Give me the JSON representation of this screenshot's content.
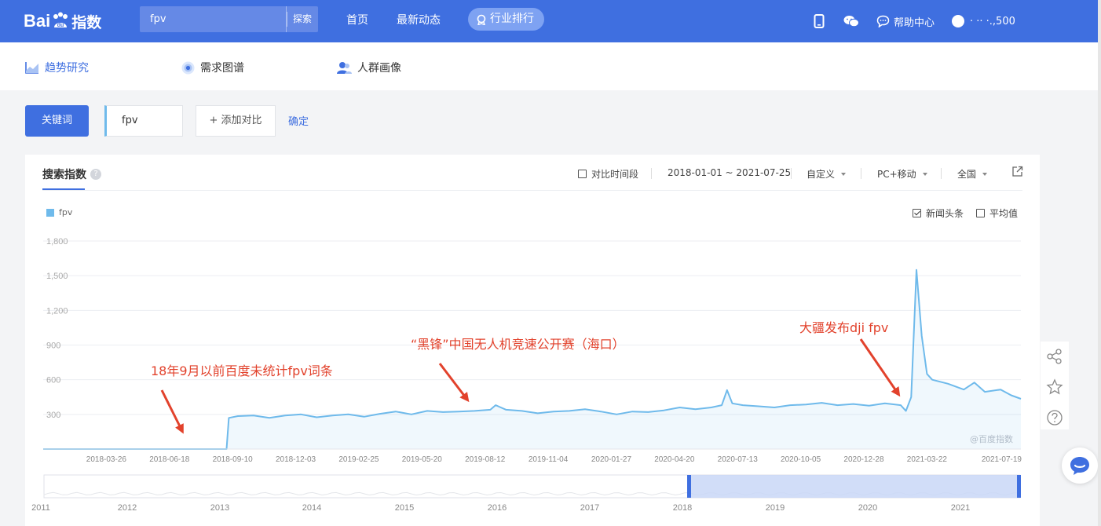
{
  "header": {
    "logo_text": "Bai",
    "logo_zh": "指数",
    "search_value": "fpv",
    "search_button": "探索",
    "nav": [
      "首页",
      "最新动态"
    ],
    "pill_label": "行业排行",
    "help": "帮助中心",
    "user": "· ·· ·.,500",
    "icons": [
      "mobile-icon",
      "wechat-icon",
      "help-chat-icon",
      "user-avatar"
    ]
  },
  "subnav": [
    {
      "label": "趋势研究",
      "icon": "trend-icon"
    },
    {
      "label": "需求图谱",
      "icon": "target-icon"
    },
    {
      "label": "人群画像",
      "icon": "people-icon"
    }
  ],
  "keyword_bar": {
    "keyword_button": "关键词",
    "keyword_value": "fpv",
    "add_compare": "+ 添加对比",
    "confirm": "确定"
  },
  "card": {
    "title": "搜索指数",
    "help_glyph": "?",
    "compare_period": "对比时间段",
    "date_range": "2018-01-01 ~ 2021-07-25",
    "custom": "自定义",
    "device": "PC+移动",
    "region": "全国",
    "legend": "fpv",
    "news_headlines": "新闻头条",
    "news_checked": true,
    "average": "平均值",
    "average_checked": false,
    "watermark": "@百度指数",
    "series_color": "#6fbaeb"
  },
  "annotations": [
    {
      "text": "18年9月以前百度未统计fpv词条"
    },
    {
      "text": "“黑锋”中国无人机竞速公开赛（海口）"
    },
    {
      "text": "大疆发布dji fpv"
    }
  ],
  "chart_data": {
    "type": "area",
    "series": [
      {
        "name": "fpv",
        "color": "#6fbaeb"
      }
    ],
    "y_ticks": [
      "1,800",
      "1,500",
      "1,200",
      "900",
      "600",
      "300"
    ],
    "ylim": [
      0,
      1800
    ],
    "x_labels": [
      "2018-03-26",
      "2018-06-18",
      "2018-09-10",
      "2018-12-03",
      "2019-02-25",
      "2019-05-20",
      "2019-08-12",
      "2019-11-04",
      "2020-01-27",
      "2020-04-20",
      "2020-07-13",
      "2020-10-05",
      "2020-12-28",
      "2021-03-22",
      "2021-07-19"
    ],
    "points": [
      [
        "2018-01-01",
        0
      ],
      [
        "2018-09-02",
        0
      ],
      [
        "2018-09-05",
        270
      ],
      [
        "2018-09-17",
        285
      ],
      [
        "2018-10-08",
        290
      ],
      [
        "2018-10-29",
        270
      ],
      [
        "2018-11-19",
        290
      ],
      [
        "2018-12-10",
        300
      ],
      [
        "2018-12-31",
        275
      ],
      [
        "2019-01-21",
        290
      ],
      [
        "2019-02-11",
        300
      ],
      [
        "2019-03-04",
        280
      ],
      [
        "2019-03-25",
        305
      ],
      [
        "2019-04-15",
        325
      ],
      [
        "2019-05-06",
        300
      ],
      [
        "2019-05-27",
        330
      ],
      [
        "2019-06-17",
        320
      ],
      [
        "2019-07-08",
        325
      ],
      [
        "2019-07-29",
        330
      ],
      [
        "2019-08-19",
        340
      ],
      [
        "2019-08-26",
        380
      ],
      [
        "2019-09-09",
        340
      ],
      [
        "2019-09-30",
        330
      ],
      [
        "2019-10-21",
        310
      ],
      [
        "2019-11-11",
        325
      ],
      [
        "2019-12-02",
        330
      ],
      [
        "2019-12-23",
        345
      ],
      [
        "2020-01-13",
        325
      ],
      [
        "2020-02-03",
        300
      ],
      [
        "2020-02-24",
        325
      ],
      [
        "2020-03-16",
        320
      ],
      [
        "2020-04-06",
        335
      ],
      [
        "2020-04-27",
        360
      ],
      [
        "2020-05-18",
        345
      ],
      [
        "2020-06-08",
        360
      ],
      [
        "2020-06-22",
        380
      ],
      [
        "2020-06-29",
        510
      ],
      [
        "2020-07-06",
        395
      ],
      [
        "2020-07-20",
        380
      ],
      [
        "2020-08-10",
        370
      ],
      [
        "2020-08-31",
        360
      ],
      [
        "2020-09-21",
        380
      ],
      [
        "2020-10-12",
        385
      ],
      [
        "2020-11-02",
        400
      ],
      [
        "2020-11-23",
        380
      ],
      [
        "2020-12-14",
        390
      ],
      [
        "2021-01-04",
        375
      ],
      [
        "2021-01-25",
        395
      ],
      [
        "2021-02-15",
        380
      ],
      [
        "2021-02-22",
        330
      ],
      [
        "2021-03-01",
        450
      ],
      [
        "2021-03-08",
        1550
      ],
      [
        "2021-03-15",
        980
      ],
      [
        "2021-03-22",
        650
      ],
      [
        "2021-03-29",
        600
      ],
      [
        "2021-04-19",
        565
      ],
      [
        "2021-05-10",
        515
      ],
      [
        "2021-05-24",
        575
      ],
      [
        "2021-06-07",
        495
      ],
      [
        "2021-06-28",
        515
      ],
      [
        "2021-07-12",
        465
      ],
      [
        "2021-07-25",
        435
      ]
    ]
  },
  "overview": {
    "year_labels_left": [
      "2011",
      "2012",
      "2013",
      "2014",
      "2015",
      "2016",
      "2017",
      "2018"
    ],
    "year_labels_right": [
      "2019",
      "2020",
      "2021"
    ]
  }
}
